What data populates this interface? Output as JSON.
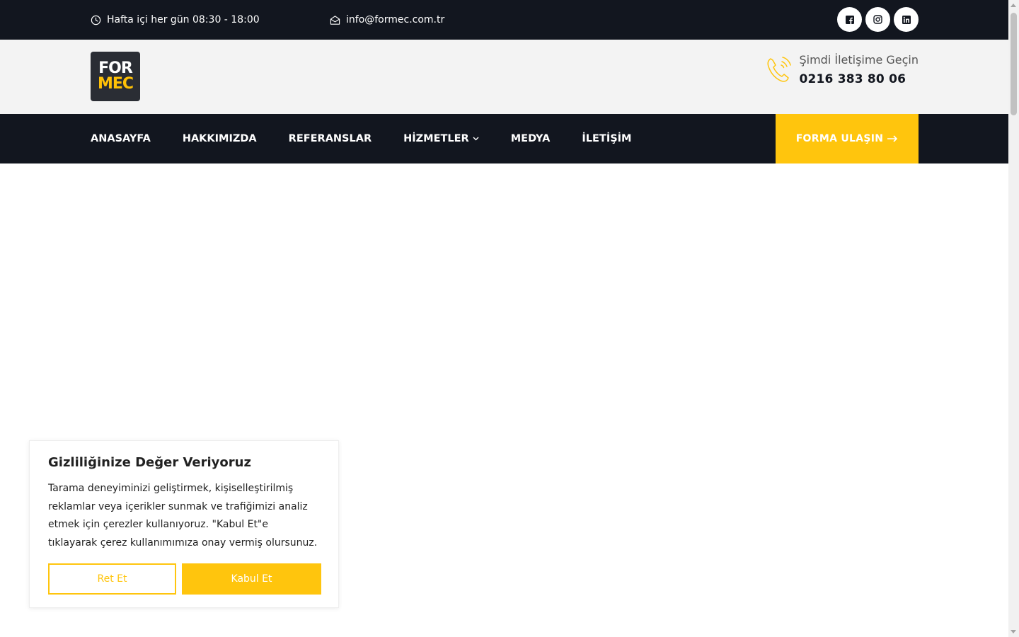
{
  "topbar": {
    "hours": "Hafta içi her gün 08:30 - 18:00",
    "email": "info@formec.com.tr",
    "socials": [
      "facebook-icon",
      "instagram-icon",
      "linkedin-icon"
    ]
  },
  "header": {
    "logo_line1": "FOR",
    "logo_line2": "MEC",
    "contact_label": "Şimdi İletişime Geçin",
    "phone": "0216 383 80 06"
  },
  "nav": {
    "items": [
      {
        "label": "ANASAYFA"
      },
      {
        "label": "HAKKIMIZDA"
      },
      {
        "label": "REFERANSLAR"
      },
      {
        "label": "HİZMETLER"
      },
      {
        "label": "MEDYA"
      },
      {
        "label": "İLETİŞİM"
      }
    ],
    "cta": "FORMA ULAŞIN"
  },
  "cookie": {
    "title": "Gizliliğinize Değer Veriyoruz",
    "text": "Tarama deneyiminizi geliştirmek, kişiselleştirilmiş reklamlar veya içerikler sunmak ve trafiğimizi analiz etmek için çerezler kullanıyoruz. \"Kabul Et\"e tıklayarak çerez kullanımımıza onay vermiş olursunuz.",
    "reject": "Ret Et",
    "accept": "Kabul Et"
  },
  "colors": {
    "dark": "#12161f",
    "accent": "#ffc50d",
    "header_bg": "#f3f3f3"
  }
}
